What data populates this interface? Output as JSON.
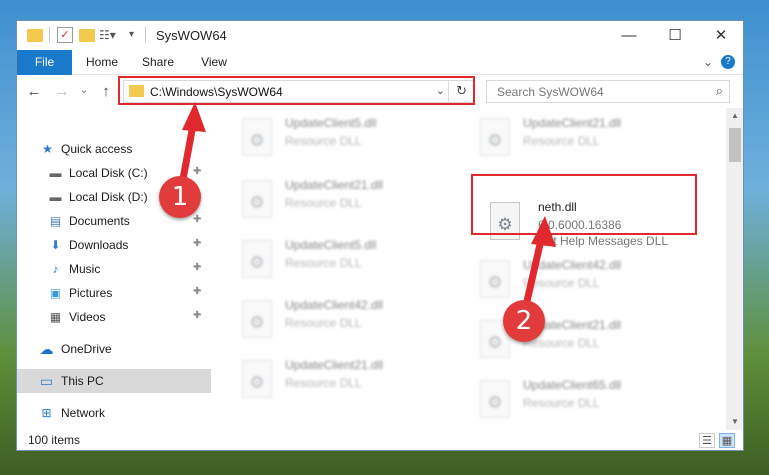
{
  "window": {
    "title": "SysWOW64"
  },
  "window_controls": {
    "minimize": "—",
    "maximize": "☐",
    "close": "✕"
  },
  "ribbon": {
    "tabs": [
      "File",
      "Home",
      "Share",
      "View"
    ],
    "collapse": "⌄",
    "help": "?"
  },
  "address": {
    "path": "C:\\Windows\\SysWOW64",
    "dropdown": "⌄",
    "refresh": "↻"
  },
  "search": {
    "placeholder": "Search SysWOW64",
    "icon": "⌕"
  },
  "nav_buttons": {
    "back": "←",
    "forward": "→",
    "recent": "⌄",
    "up": "↑"
  },
  "nav_pane": {
    "items": [
      {
        "label": "Quick access",
        "icon": "star-icon",
        "glyph": "★",
        "color": "#2b7bd3",
        "pinned": false
      },
      {
        "label": "Local Disk (C:)",
        "icon": "drive-icon",
        "glyph": "▬",
        "color": "#666666",
        "pinned": true
      },
      {
        "label": "Local Disk (D:)",
        "icon": "drive-icon",
        "glyph": "▬",
        "color": "#666666",
        "pinned": true
      },
      {
        "label": "Documents",
        "icon": "documents-icon",
        "glyph": "▤",
        "color": "#4a78b5",
        "pinned": true
      },
      {
        "label": "Downloads",
        "icon": "downloads-icon",
        "glyph": "⬇",
        "color": "#2b7bd3",
        "pinned": true
      },
      {
        "label": "Music",
        "icon": "music-icon",
        "glyph": "♪",
        "color": "#2b7bd3",
        "pinned": true
      },
      {
        "label": "Pictures",
        "icon": "pictures-icon",
        "glyph": "▣",
        "color": "#3a9ad9",
        "pinned": true
      },
      {
        "label": "Videos",
        "icon": "videos-icon",
        "glyph": "▦",
        "color": "#555555",
        "pinned": true
      },
      {
        "label": "OneDrive",
        "icon": "onedrive-icon",
        "glyph": "☁",
        "color": "#1b6fc7",
        "pinned": false
      },
      {
        "label": "This PC",
        "icon": "this-pc-icon",
        "glyph": "▭",
        "color": "#2b7bd3",
        "pinned": false,
        "selected": true
      },
      {
        "label": "Network",
        "icon": "network-icon",
        "glyph": "⊞",
        "color": "#2b7bd3",
        "pinned": false
      }
    ],
    "pin_glyph": "📌"
  },
  "files": {
    "left": [
      {
        "name": "UpdateClient5.dll",
        "desc": "Resource DLL"
      },
      {
        "name": "UpdateClient21.dll",
        "desc": "Resource DLL"
      },
      {
        "name": "UpdateClient5.dll",
        "desc": "Resource DLL"
      },
      {
        "name": "UpdateClient42.dll",
        "desc": "Resource DLL"
      },
      {
        "name": "UpdateClient21.dll",
        "desc": "Resource DLL"
      }
    ],
    "right": [
      {
        "name": "UpdateClient21.dll",
        "desc": "Resource DLL"
      },
      {
        "name": "UpdateClient42.dll",
        "desc": "Resource DLL"
      },
      {
        "name": "UpdateClient21.dll",
        "desc": "Resource DLL"
      },
      {
        "name": "UpdateClient65.dll",
        "desc": "Resource DLL"
      }
    ],
    "highlighted": {
      "name": "neth.dll",
      "version": "6.0.6000.16386",
      "desc": "Net Help Messages DLL"
    }
  },
  "status": {
    "items_count": "100 items"
  },
  "scrollbar": {
    "up": "▲",
    "down": "▼"
  },
  "annotations": {
    "step1": "1",
    "step2": "2",
    "color": "#e0282e"
  }
}
